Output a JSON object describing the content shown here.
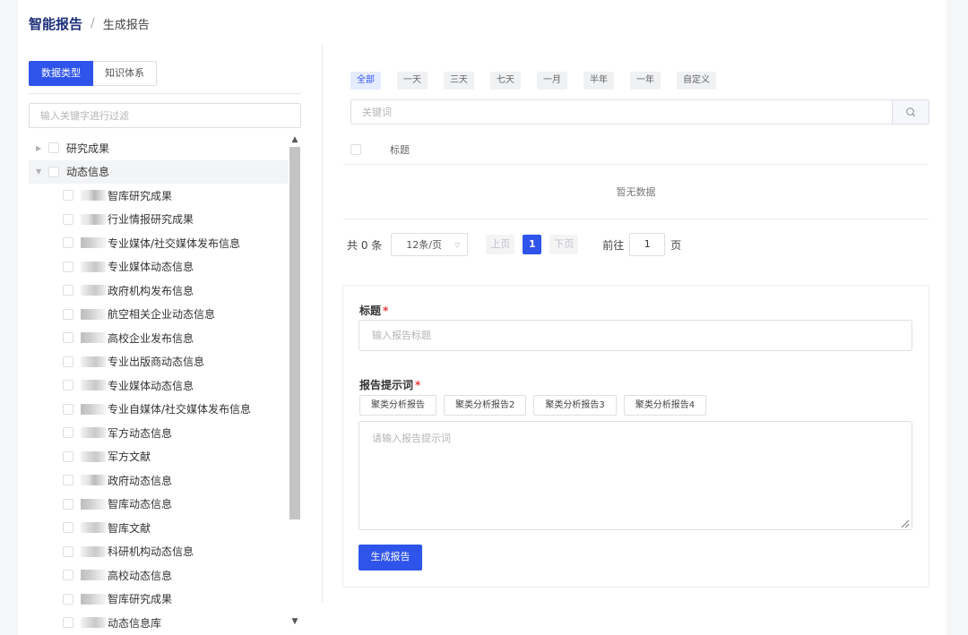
{
  "breadcrumb": {
    "main": "智能报告",
    "separator": "/",
    "sub": "生成报告"
  },
  "left_panel": {
    "tabs": [
      {
        "label": "数据类型",
        "active": true
      },
      {
        "label": "知识体系",
        "active": false
      }
    ],
    "filter_placeholder": "输入关键字进行过滤",
    "tree": {
      "node1": {
        "label": "研究成果",
        "expanded": false
      },
      "node2": {
        "label": "动态信息",
        "expanded": true,
        "children": [
          "智库研究成果",
          "行业情报研究成果",
          "专业媒体/社交媒体发布信息",
          "专业媒体动态信息",
          "政府机构发布信息",
          "航空相关企业动态信息",
          "高校企业发布信息",
          "专业出版商动态信息",
          "专业媒体动态信息",
          "专业自媒体/社交媒体发布信息",
          "军方动态信息",
          "军方文献",
          "政府动态信息",
          "智库动态信息",
          "智库文献",
          "科研机构动态信息",
          "高校动态信息",
          "智库研究成果",
          "动态信息库"
        ]
      }
    }
  },
  "right_panel": {
    "time_ranges": [
      "全部",
      "一天",
      "三天",
      "七天",
      "一月",
      "半年",
      "一年",
      "自定义"
    ],
    "active_range": "全部",
    "keyword_placeholder": "关键词",
    "table": {
      "column_title": "标题",
      "empty_text": "暂无数据"
    },
    "pagination": {
      "total_text": "共 0 条",
      "page_size": "12条/页",
      "prev": "上页",
      "current_page": "1",
      "next": "下页",
      "goto_label": "前往",
      "goto_value": "1",
      "page_suffix": "页"
    },
    "form": {
      "title_label": "标题",
      "title_placeholder": "输入报告标题",
      "prompt_label": "报告提示词",
      "required_mark": "*",
      "prompt_templates": [
        "聚类分析报告",
        "聚类分析报告2",
        "聚类分析报告3",
        "聚类分析报告4"
      ],
      "prompt_placeholder": "请输入报告提示词",
      "submit": "生成报告"
    }
  },
  "colors": {
    "primary": "#2f54eb",
    "brand_title": "#1d2f7a",
    "required": "#e53935"
  }
}
